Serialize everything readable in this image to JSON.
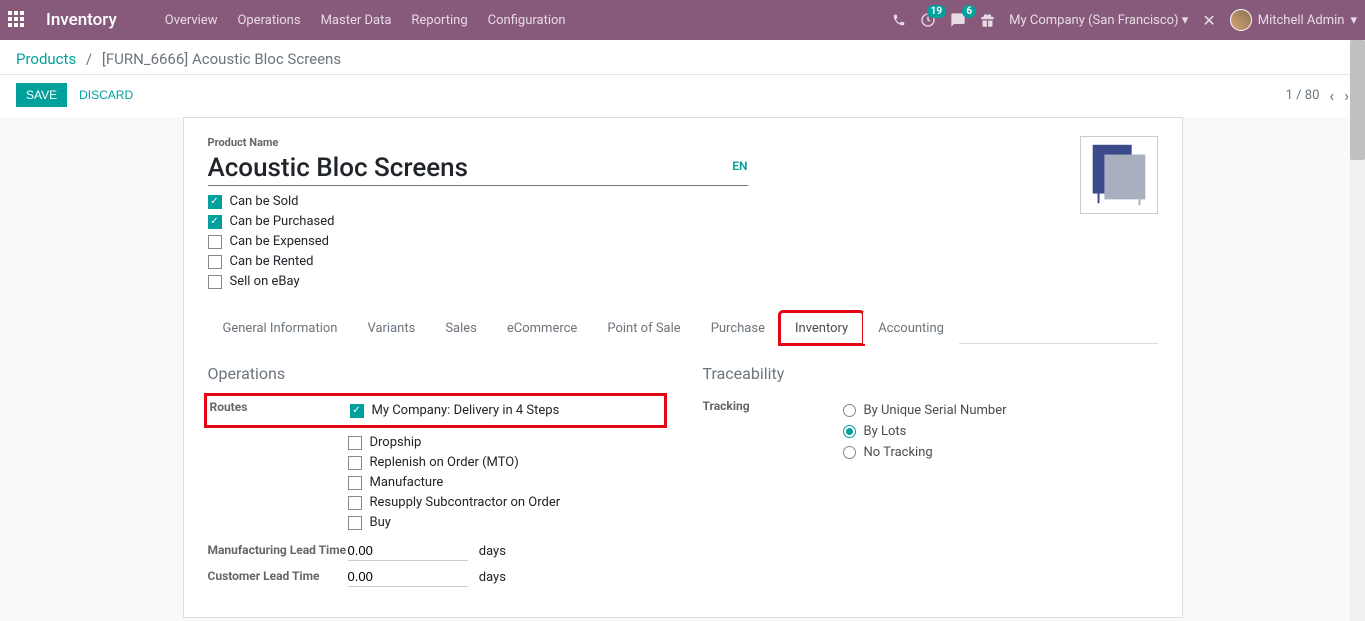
{
  "navbar": {
    "app_title": "Inventory",
    "menu": [
      "Overview",
      "Operations",
      "Master Data",
      "Reporting",
      "Configuration"
    ],
    "activity_count": "19",
    "message_count": "6",
    "company": "My Company (San Francisco)",
    "user": "Mitchell Admin"
  },
  "breadcrumb": {
    "parent": "Products",
    "current": "[FURN_6666] Acoustic Bloc Screens"
  },
  "actions": {
    "save": "SAVE",
    "discard": "DISCARD",
    "pager": "1 / 80"
  },
  "product": {
    "label": "Product Name",
    "name": "Acoustic Bloc Screens",
    "lang": "EN",
    "options": [
      {
        "label": "Can be Sold",
        "checked": true
      },
      {
        "label": "Can be Purchased",
        "checked": true
      },
      {
        "label": "Can be Expensed",
        "checked": false
      },
      {
        "label": "Can be Rented",
        "checked": false
      },
      {
        "label": "Sell on eBay",
        "checked": false
      }
    ]
  },
  "tabs": [
    "General Information",
    "Variants",
    "Sales",
    "eCommerce",
    "Point of Sale",
    "Purchase",
    "Inventory",
    "Accounting"
  ],
  "operations": {
    "title": "Operations",
    "routes_label": "Routes",
    "routes": [
      {
        "label": "My Company: Delivery in 4 Steps",
        "checked": true
      },
      {
        "label": "Dropship",
        "checked": false
      },
      {
        "label": "Replenish on Order (MTO)",
        "checked": false
      },
      {
        "label": "Manufacture",
        "checked": false
      },
      {
        "label": "Resupply Subcontractor on Order",
        "checked": false
      },
      {
        "label": "Buy",
        "checked": false
      }
    ],
    "mfg_lead_label": "Manufacturing Lead Time",
    "mfg_lead_value": "0.00",
    "cust_lead_label": "Customer Lead Time",
    "cust_lead_value": "0.00",
    "days_unit": "days"
  },
  "traceability": {
    "title": "Traceability",
    "tracking_label": "Tracking",
    "options": [
      {
        "label": "By Unique Serial Number",
        "checked": false
      },
      {
        "label": "By Lots",
        "checked": true
      },
      {
        "label": "No Tracking",
        "checked": false
      }
    ]
  }
}
